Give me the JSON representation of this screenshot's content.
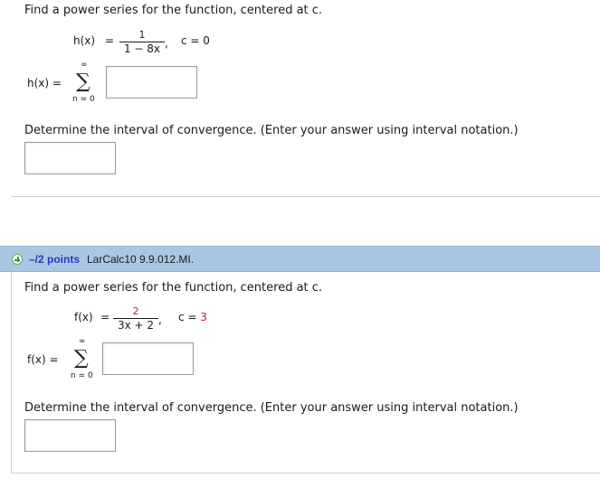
{
  "q1": {
    "prompt": "Find a power series for the function, centered at c.",
    "func_label": "h(x)",
    "equals": "=",
    "numerator": "1",
    "denominator": "1 − 8x",
    "comma": ",",
    "center": "c = 0",
    "sum_label": "h(x) =",
    "sum_upper": "∞",
    "sum_symbol": "∑",
    "sum_lower": "n = 0",
    "interval_prompt": "Determine the interval of convergence. (Enter your answer using interval notation.)"
  },
  "q2": {
    "points": "–/2 points",
    "code": "LarCalc10 9.9.012.MI.",
    "prompt": "Find a power series for the function, centered at c.",
    "func_label": "f(x)",
    "equals": "=",
    "numerator": "2",
    "denominator": "3x + 2",
    "comma": ",",
    "center_prefix": "c = ",
    "center_value": "3",
    "sum_label": "f(x) =",
    "sum_upper": "∞",
    "sum_symbol": "∑",
    "sum_lower": "n = 0",
    "interval_prompt": "Determine the interval of convergence. (Enter your answer using interval notation.)"
  },
  "colors": {
    "header_bg": "#a9c7e3",
    "points_text": "#2a39b4",
    "highlight_red": "#c0212b",
    "plus_green": "#3a9a2a"
  }
}
